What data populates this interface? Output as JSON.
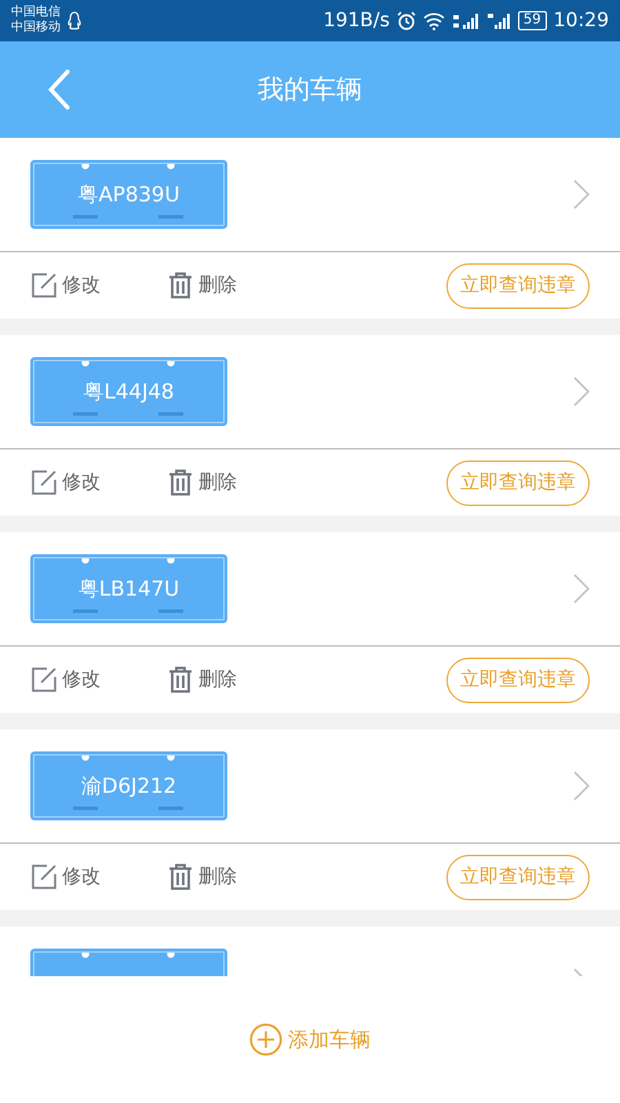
{
  "status_bar": {
    "carriers": [
      "中国电信",
      "中国移动"
    ],
    "speed": "191B/s",
    "battery": "59",
    "time": "10:29"
  },
  "header": {
    "title": "我的车辆"
  },
  "vehicles": [
    {
      "plate": "粤AP839U",
      "edit": "修改",
      "delete": "删除",
      "query": "立即查询违章"
    },
    {
      "plate": "粤L44J48",
      "edit": "修改",
      "delete": "删除",
      "query": "立即查询违章"
    },
    {
      "plate": "粤LB147U",
      "edit": "修改",
      "delete": "删除",
      "query": "立即查询违章"
    },
    {
      "plate": "渝D6J212",
      "edit": "修改",
      "delete": "删除",
      "query": "立即查询违章"
    }
  ],
  "more_below": true,
  "add_button": {
    "label": "添加车辆"
  }
}
